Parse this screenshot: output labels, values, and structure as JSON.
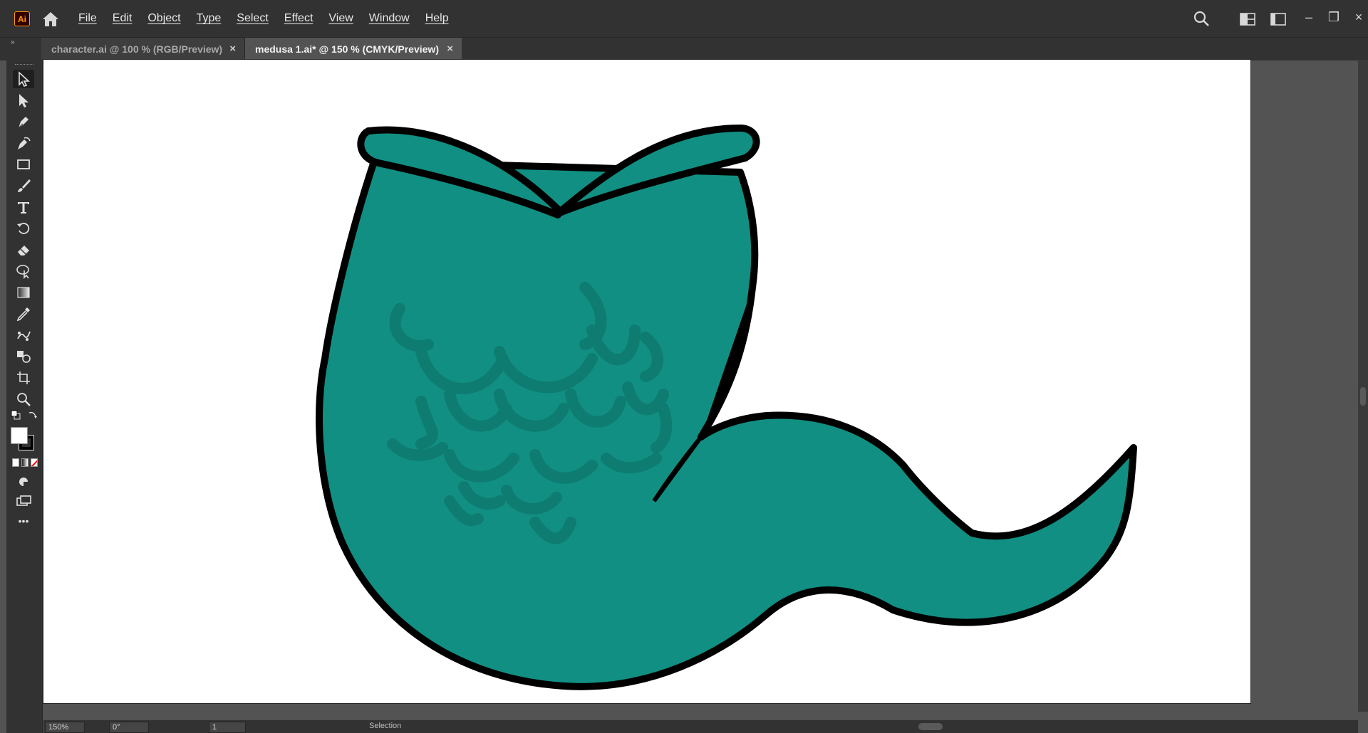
{
  "app": {
    "logo_text": "Ai",
    "accent_color": "#ff9a00"
  },
  "menu": [
    "File",
    "Edit",
    "Object",
    "Type",
    "Select",
    "Effect",
    "View",
    "Window",
    "Help"
  ],
  "tabs": [
    {
      "label": "character.ai @ 100 % (RGB/Preview)",
      "close": "×",
      "active": false
    },
    {
      "label": "medusa 1.ai* @ 150 % (CMYK/Preview)",
      "close": "×",
      "active": true
    }
  ],
  "window_controls": {
    "minimize": "–",
    "restore": "❐",
    "close": "×"
  },
  "toolbar": {
    "tools": [
      "selection-tool-icon",
      "direct-selection-tool-icon",
      "pen-tool-icon",
      "curvature-tool-icon",
      "rectangle-tool-icon",
      "paintbrush-tool-icon",
      "type-tool-icon",
      "rotate-tool-icon",
      "eraser-tool-icon",
      "shape-builder-tool-icon",
      "gradient-tool-icon",
      "eyedropper-tool-icon",
      "puppet-warp-tool-icon",
      "blend-tool-icon",
      "artboard-tool-icon",
      "zoom-tool-icon"
    ],
    "more": "•••"
  },
  "colors": {
    "fill": "#ffffff",
    "stroke": "#000000",
    "tail_fill": "#118f82",
    "scale_fill": "#0e7c70",
    "outline": "#000000"
  },
  "status": {
    "zoom": "150%",
    "rotation": "0°",
    "artboard": "1",
    "tool": "Selection"
  }
}
